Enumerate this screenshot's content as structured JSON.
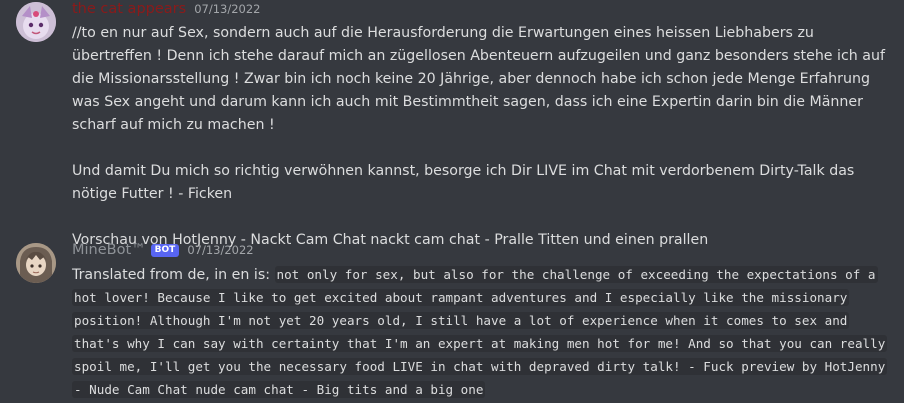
{
  "messages": [
    {
      "username": "the cat appears",
      "timestamp": "07/13/2022",
      "avatar": "pink-character-avatar",
      "content": "//to en nur auf Sex, sondern auch auf die Herausforderung die Erwartungen eines heissen Liebhabers zu übertreffen ! Denn ich stehe darauf mich an zügellosen Abenteuern aufzugeilen und ganz besonders stehe ich auf die Missionarsstellung ! Zwar bin ich noch keine 20 Jährige, aber dennoch habe ich schon jede Menge Erfahrung was Sex angeht und darum kann ich auch mit Bestimmtheit sagen, dass ich eine Expertin darin bin die Männer scharf auf mich zu machen !\n\nUnd damit Du mich so richtig verwöhnen kannst, besorge ich Dir LIVE im Chat mit verdorbenem Dirty-Talk das nötige Futter ! - Ficken\n\nVorschau von HotJenny - Nackt Cam Chat nackt cam chat - Pralle Titten und einen prallen"
    },
    {
      "username": "MineBot™",
      "bot_tag": "BOT",
      "timestamp": "07/13/2022",
      "avatar": "anime-character-avatar",
      "prefix": "Translated from de, in en is: ",
      "code_lines": [
        "not only for sex, but also for the challenge of exceeding the expectations of a",
        "hot lover! Because I like to get excited about rampant adventures and I especially like the missionary",
        "position! Although I'm not yet 20 years old, I still have a lot of experience when it comes to sex and",
        "that's why I can say with certainty that I'm an expert at making men hot for me! And so that you can really",
        "spoil me, I'll get you the necessary food LIVE in chat with depraved dirty talk! - Fuck preview by HotJenny",
        "- Nude Cam Chat nude cam chat - Big tits and a big one"
      ]
    }
  ],
  "colors": {
    "background": "#36393f",
    "text": "#dcddde",
    "timestamp": "#a3a6aa",
    "user1": "#8b1a1a",
    "user2": "#8e9297",
    "bot_tag": "#5865f2",
    "code_bg": "#2f3136"
  }
}
